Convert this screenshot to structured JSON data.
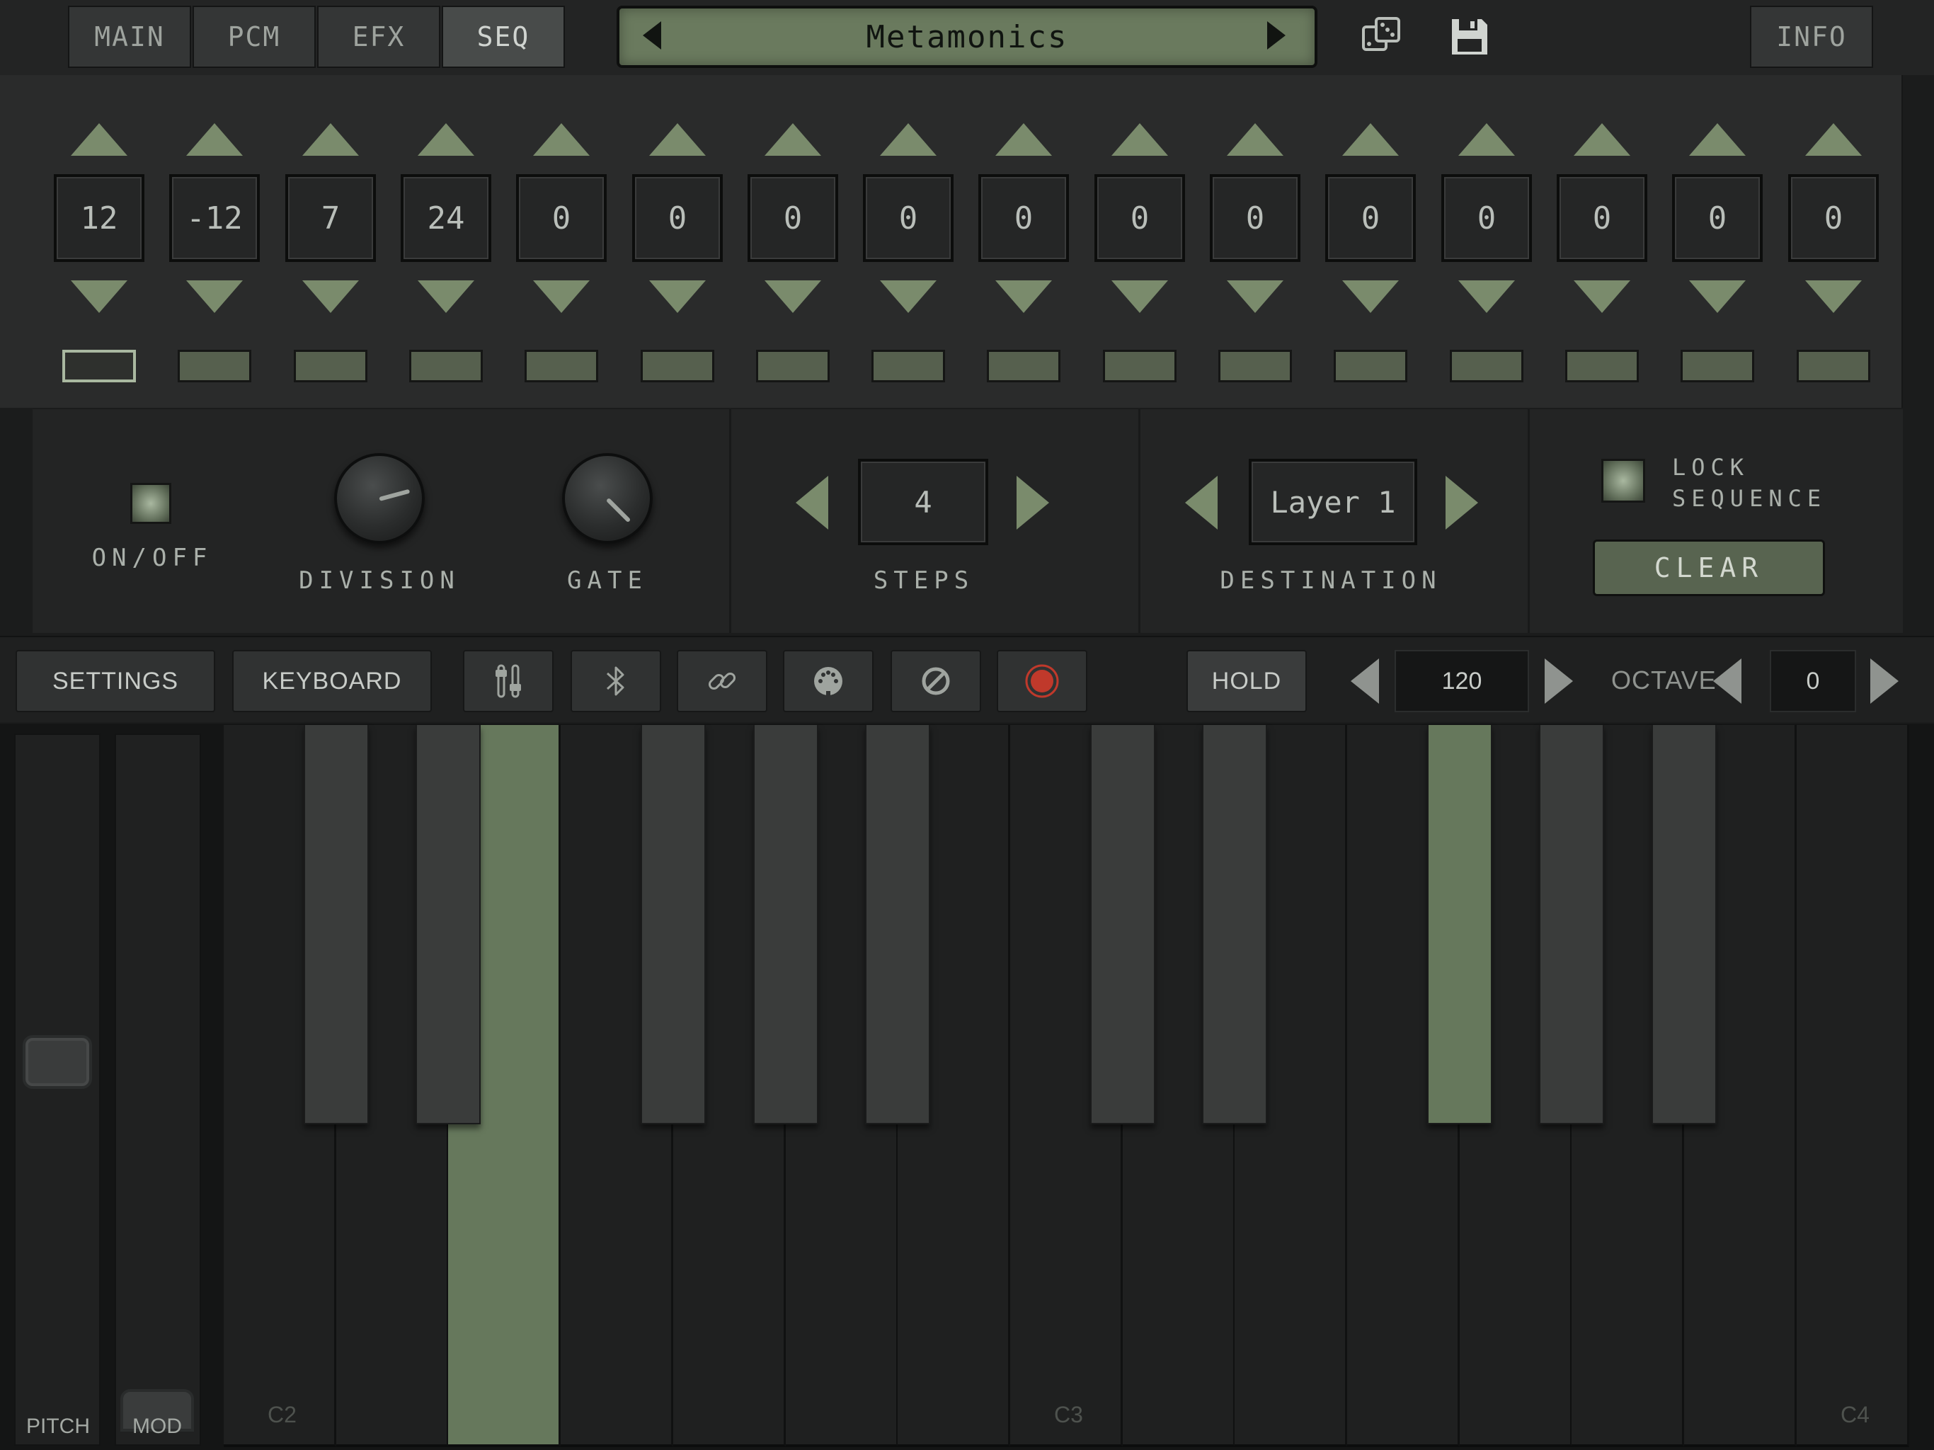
{
  "tabs": [
    {
      "label": "MAIN",
      "active": false
    },
    {
      "label": "PCM",
      "active": false
    },
    {
      "label": "EFX",
      "active": false
    },
    {
      "label": "SEQ",
      "active": true
    }
  ],
  "preset": {
    "name": "Metamonics"
  },
  "info_label": "INFO",
  "icons": {
    "randomize": "dice-icon",
    "save": "floppy-disk-icon"
  },
  "sequencer": {
    "steps": [
      {
        "value": "12"
      },
      {
        "value": "-12"
      },
      {
        "value": "7"
      },
      {
        "value": "24"
      },
      {
        "value": "0"
      },
      {
        "value": "0"
      },
      {
        "value": "0"
      },
      {
        "value": "0"
      },
      {
        "value": "0"
      },
      {
        "value": "0"
      },
      {
        "value": "0"
      },
      {
        "value": "0"
      },
      {
        "value": "0"
      },
      {
        "value": "0"
      },
      {
        "value": "0"
      },
      {
        "value": "0"
      }
    ],
    "active_step": 1
  },
  "controls": {
    "on_off_label": "ON/OFF",
    "division_label": "DIVISION",
    "gate_label": "GATE",
    "steps_label": "STEPS",
    "steps_value": "4",
    "destination_label": "DESTINATION",
    "destination_value": "Layer 1",
    "lock_label_1": "LOCK",
    "lock_label_2": "SEQUENCE",
    "clear_label": "CLEAR"
  },
  "toolbar": {
    "settings_label": "SETTINGS",
    "keyboard_label": "KEYBOARD",
    "icons": [
      "sliders-icon",
      "bluetooth-icon",
      "link-icon",
      "midi-port-icon",
      "panic-stop-icon",
      "record-icon"
    ],
    "hold_label": "HOLD",
    "tempo_value": "120",
    "octave_label": "OCTAVE",
    "octave_value": "0"
  },
  "keyboard": {
    "pitch_label": "PITCH",
    "mod_label": "MOD",
    "note_labels": [
      "C2",
      "C3",
      "C4"
    ],
    "pressed_notes": [
      "E2",
      "F#3"
    ]
  },
  "colors": {
    "accent": "#7a8b6c",
    "pressed_key": "#66785c",
    "record": "#c0392b",
    "preset_display": "#6a7a5e"
  }
}
